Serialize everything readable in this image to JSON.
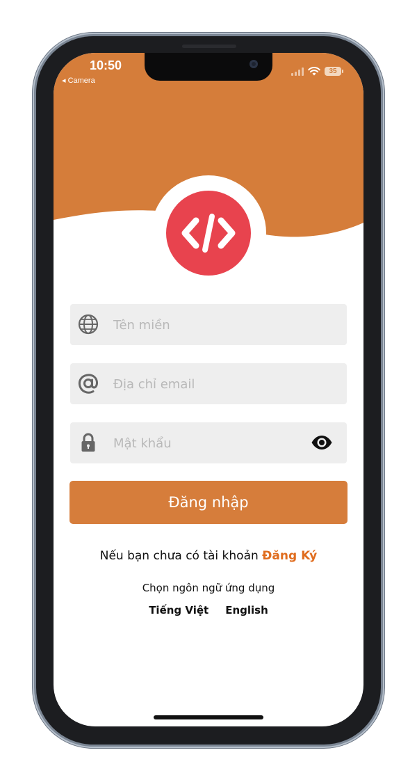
{
  "status_bar": {
    "time": "10:50",
    "back_label": "◂ Camera",
    "battery": "35"
  },
  "colors": {
    "header": "#d57d3a",
    "logo": "#e8434e",
    "button": "#d67d3b",
    "link": "#e06d1f",
    "field_bg": "#eeeeee"
  },
  "form": {
    "domain_placeholder": "Tên miền",
    "email_placeholder": "Địa chỉ email",
    "password_placeholder": "Mật khẩu",
    "login_label": "Đăng nhập"
  },
  "register": {
    "prompt": "Nếu bạn chưa có tài khoản",
    "link_label": "Đăng Ký"
  },
  "language": {
    "prompt": "Chọn ngôn ngữ ứng dụng",
    "options": [
      "Tiếng Việt",
      "English"
    ]
  },
  "icons": {
    "domain": "globe-icon",
    "email": "at-sign-icon",
    "password": "lock-icon",
    "toggle": "eye-icon",
    "logo": "code-brackets-icon"
  }
}
